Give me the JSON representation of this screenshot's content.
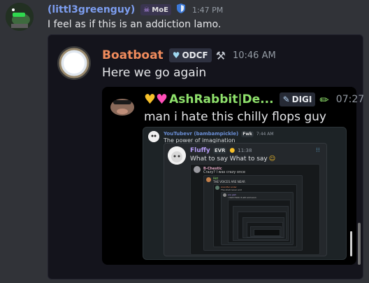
{
  "msg1": {
    "username": "(littl3greenguy)",
    "tag": "MoE",
    "time": "1:47 PM",
    "text": "I feel as if this is an addiction lamo."
  },
  "msg2": {
    "username": "Boatboat",
    "tag": "ODCF",
    "time": "10:46 AM",
    "text": "Here we go again"
  },
  "msg3": {
    "username": "AshRabbit|De...",
    "tag": "DIGI",
    "time": "07:27",
    "text": "man i hate this chilly flops guy"
  },
  "msg4": {
    "username": "YouTubevr (bambampickle)",
    "tag": "Fwk",
    "time": "7:44 AM",
    "text": "The power of imagination"
  },
  "msg5": {
    "username": "Fluffy",
    "tag": "EVR",
    "time": "11:38",
    "text": "What to say What to say"
  },
  "msg6": {
    "username": "B-Chestic",
    "text": "Crazy? I was crazy once"
  },
  "msg7": {
    "username": "Hot",
    "text": "THE VOICES ARE NEAR"
  },
  "msg8": {
    "username": "Arandfer ender",
    "text": "The shall never end"
  },
  "msg9": {
    "username": "ere gish",
    "tag": "PIE",
    "text": "i dont think it will end soon"
  },
  "colors": {
    "bg": "#313338",
    "embed1": "#1e1e2e",
    "embed2": "#000000",
    "embed3": "#1b2124",
    "green_name": "#3ba55c",
    "purple_name": "#b59cf5",
    "orange_name": "#e8896b",
    "lime_name": "#8ee06b"
  }
}
